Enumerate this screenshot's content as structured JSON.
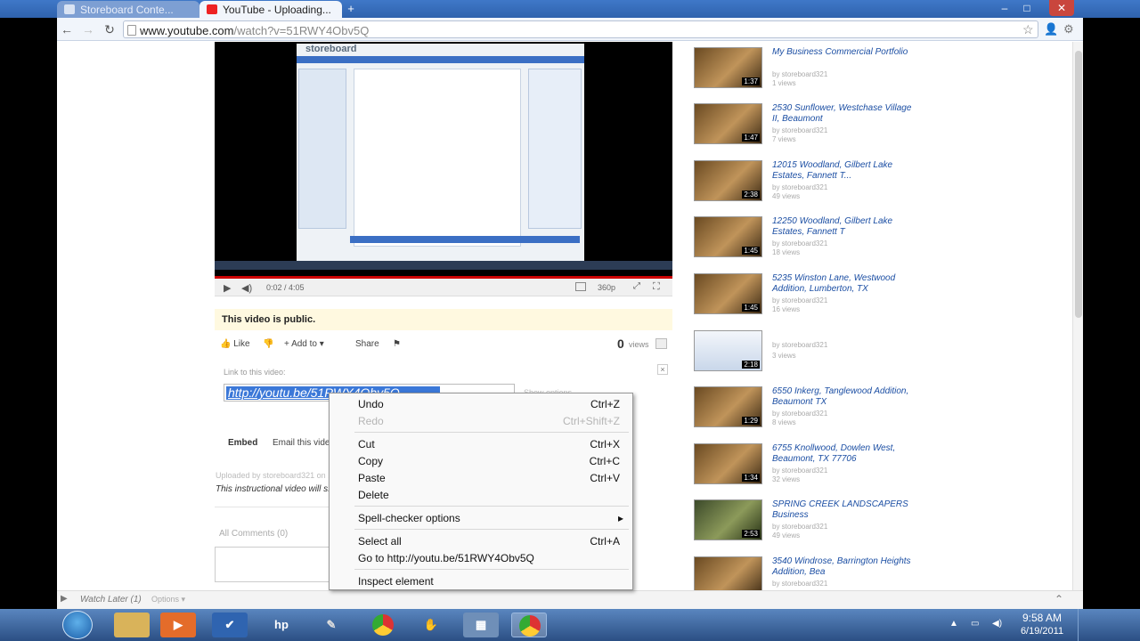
{
  "browser": {
    "tabs": [
      {
        "title": "Storeboard Conte..."
      },
      {
        "title": "YouTube - Uploading..."
      }
    ],
    "url_host": "www.youtube.com",
    "url_path": "/watch?v=51RWY4Obv5Q"
  },
  "video": {
    "screen_logo": "storeboard",
    "time": "0:02 / 4:05",
    "quality": "360p"
  },
  "page": {
    "public_notice": "This video is public.",
    "actions": {
      "like": "Like",
      "add_to": "Add to",
      "share": "Share"
    },
    "views_count": "0",
    "views_label": "views",
    "link_label": "Link to this video:",
    "link_value": "http://youtu.be/51RWY4Obv5Q",
    "show_options": "Show options",
    "embed": "Embed",
    "email": "Email this video",
    "uploaded_by": "Uploaded by storeboard321 on ...",
    "description": "This instructional video will s...",
    "comments_label": "All Comments (0)"
  },
  "related": [
    {
      "title": "My Business Commercial Portfolio",
      "by": "by storeboard321",
      "views": "1 views",
      "duration": "1:37"
    },
    {
      "title": "2530 Sunflower, Westchase Village II, Beaumont",
      "by": "by storeboard321",
      "views": "7 views",
      "duration": "1:47"
    },
    {
      "title": "12015 Woodland, Gilbert Lake Estates, Fannett T...",
      "by": "by storeboard321",
      "views": "49 views",
      "duration": "2:38"
    },
    {
      "title": "12250 Woodland, Gilbert Lake Estates, Fannett T",
      "by": "by storeboard321",
      "views": "18 views",
      "duration": "1:45"
    },
    {
      "title": "5235 Winston Lane, Westwood Addition, Lumberton, TX",
      "by": "by storeboard321",
      "views": "16 views",
      "duration": "1:45"
    },
    {
      "title": "",
      "by": "by storeboard321",
      "views": "3 views",
      "duration": "2:18"
    },
    {
      "title": "6550 Inkerg, Tanglewood Addition, Beaumont TX",
      "by": "by storeboard321",
      "views": "8 views",
      "duration": "1:29"
    },
    {
      "title": "6755 Knollwood, Dowlen West, Beaumont, TX 77706",
      "by": "by storeboard321",
      "views": "32 views",
      "duration": "1:34"
    },
    {
      "title": "SPRING CREEK LANDSCAPERS Business",
      "by": "by storeboard321",
      "views": "49 views",
      "duration": "2:53"
    },
    {
      "title": "3540 Windrose, Barrington Heights Addition, Bea",
      "by": "by storeboard321",
      "views": "",
      "duration": ""
    }
  ],
  "watch_later": {
    "label": "Watch Later (1)",
    "options": "Options"
  },
  "context_menu": {
    "undo": "Undo",
    "undo_sc": "Ctrl+Z",
    "redo": "Redo",
    "redo_sc": "Ctrl+Shift+Z",
    "cut": "Cut",
    "cut_sc": "Ctrl+X",
    "copy": "Copy",
    "copy_sc": "Ctrl+C",
    "paste": "Paste",
    "paste_sc": "Ctrl+V",
    "delete": "Delete",
    "spell": "Spell-checker options",
    "select_all": "Select all",
    "select_all_sc": "Ctrl+A",
    "goto": "Go to http://youtu.be/51RWY4Obv5Q",
    "inspect": "Inspect element"
  },
  "taskbar": {
    "hp": "hp",
    "time": "9:58 AM",
    "date": "6/19/2011"
  }
}
